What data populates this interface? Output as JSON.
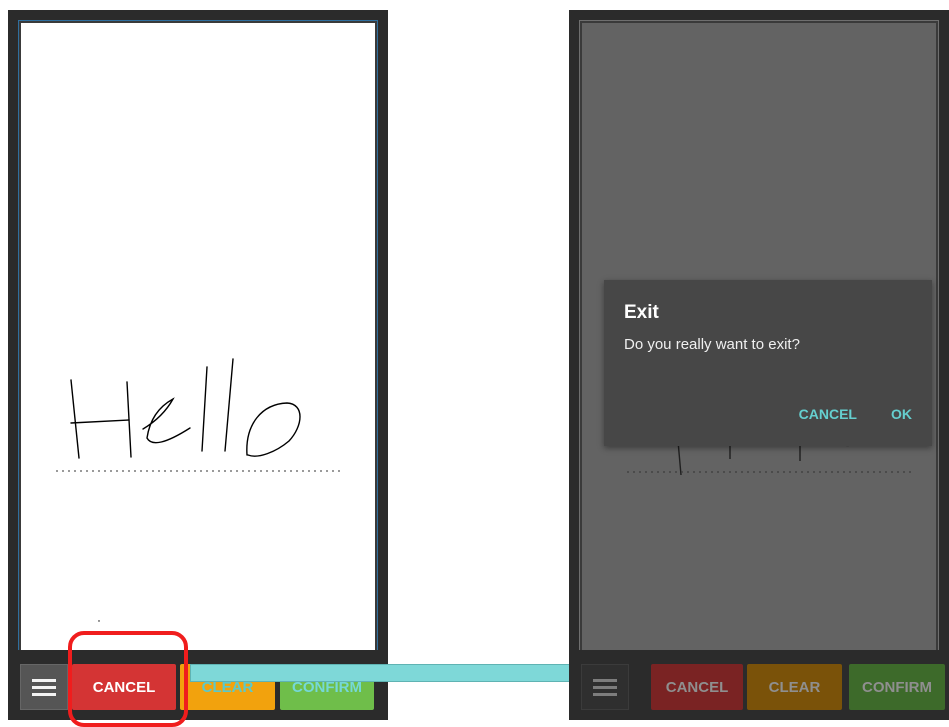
{
  "left_screen": {
    "handwriting": "Hello",
    "buttons": {
      "cancel": "CANCEL",
      "clear": "CLEAR",
      "confirm": "CONFIRM"
    }
  },
  "right_screen": {
    "buttons": {
      "cancel": "CANCEL",
      "clear": "CLEAR",
      "confirm": "CONFIRM"
    },
    "dialog": {
      "title": "Exit",
      "message": "Do you really want to exit?",
      "cancel_label": "CANCEL",
      "ok_label": "OK"
    }
  },
  "colors": {
    "cancel": "#d43434",
    "clear": "#f2a20d",
    "confirm": "#6fbe4a",
    "highlight": "#f01d1d",
    "arrow": "#7ed8d8",
    "dialog_bg": "#474747",
    "dialog_action": "#65cfcf"
  },
  "icons": {
    "menu": "menu-icon",
    "arrow": "arrow-right-icon"
  }
}
